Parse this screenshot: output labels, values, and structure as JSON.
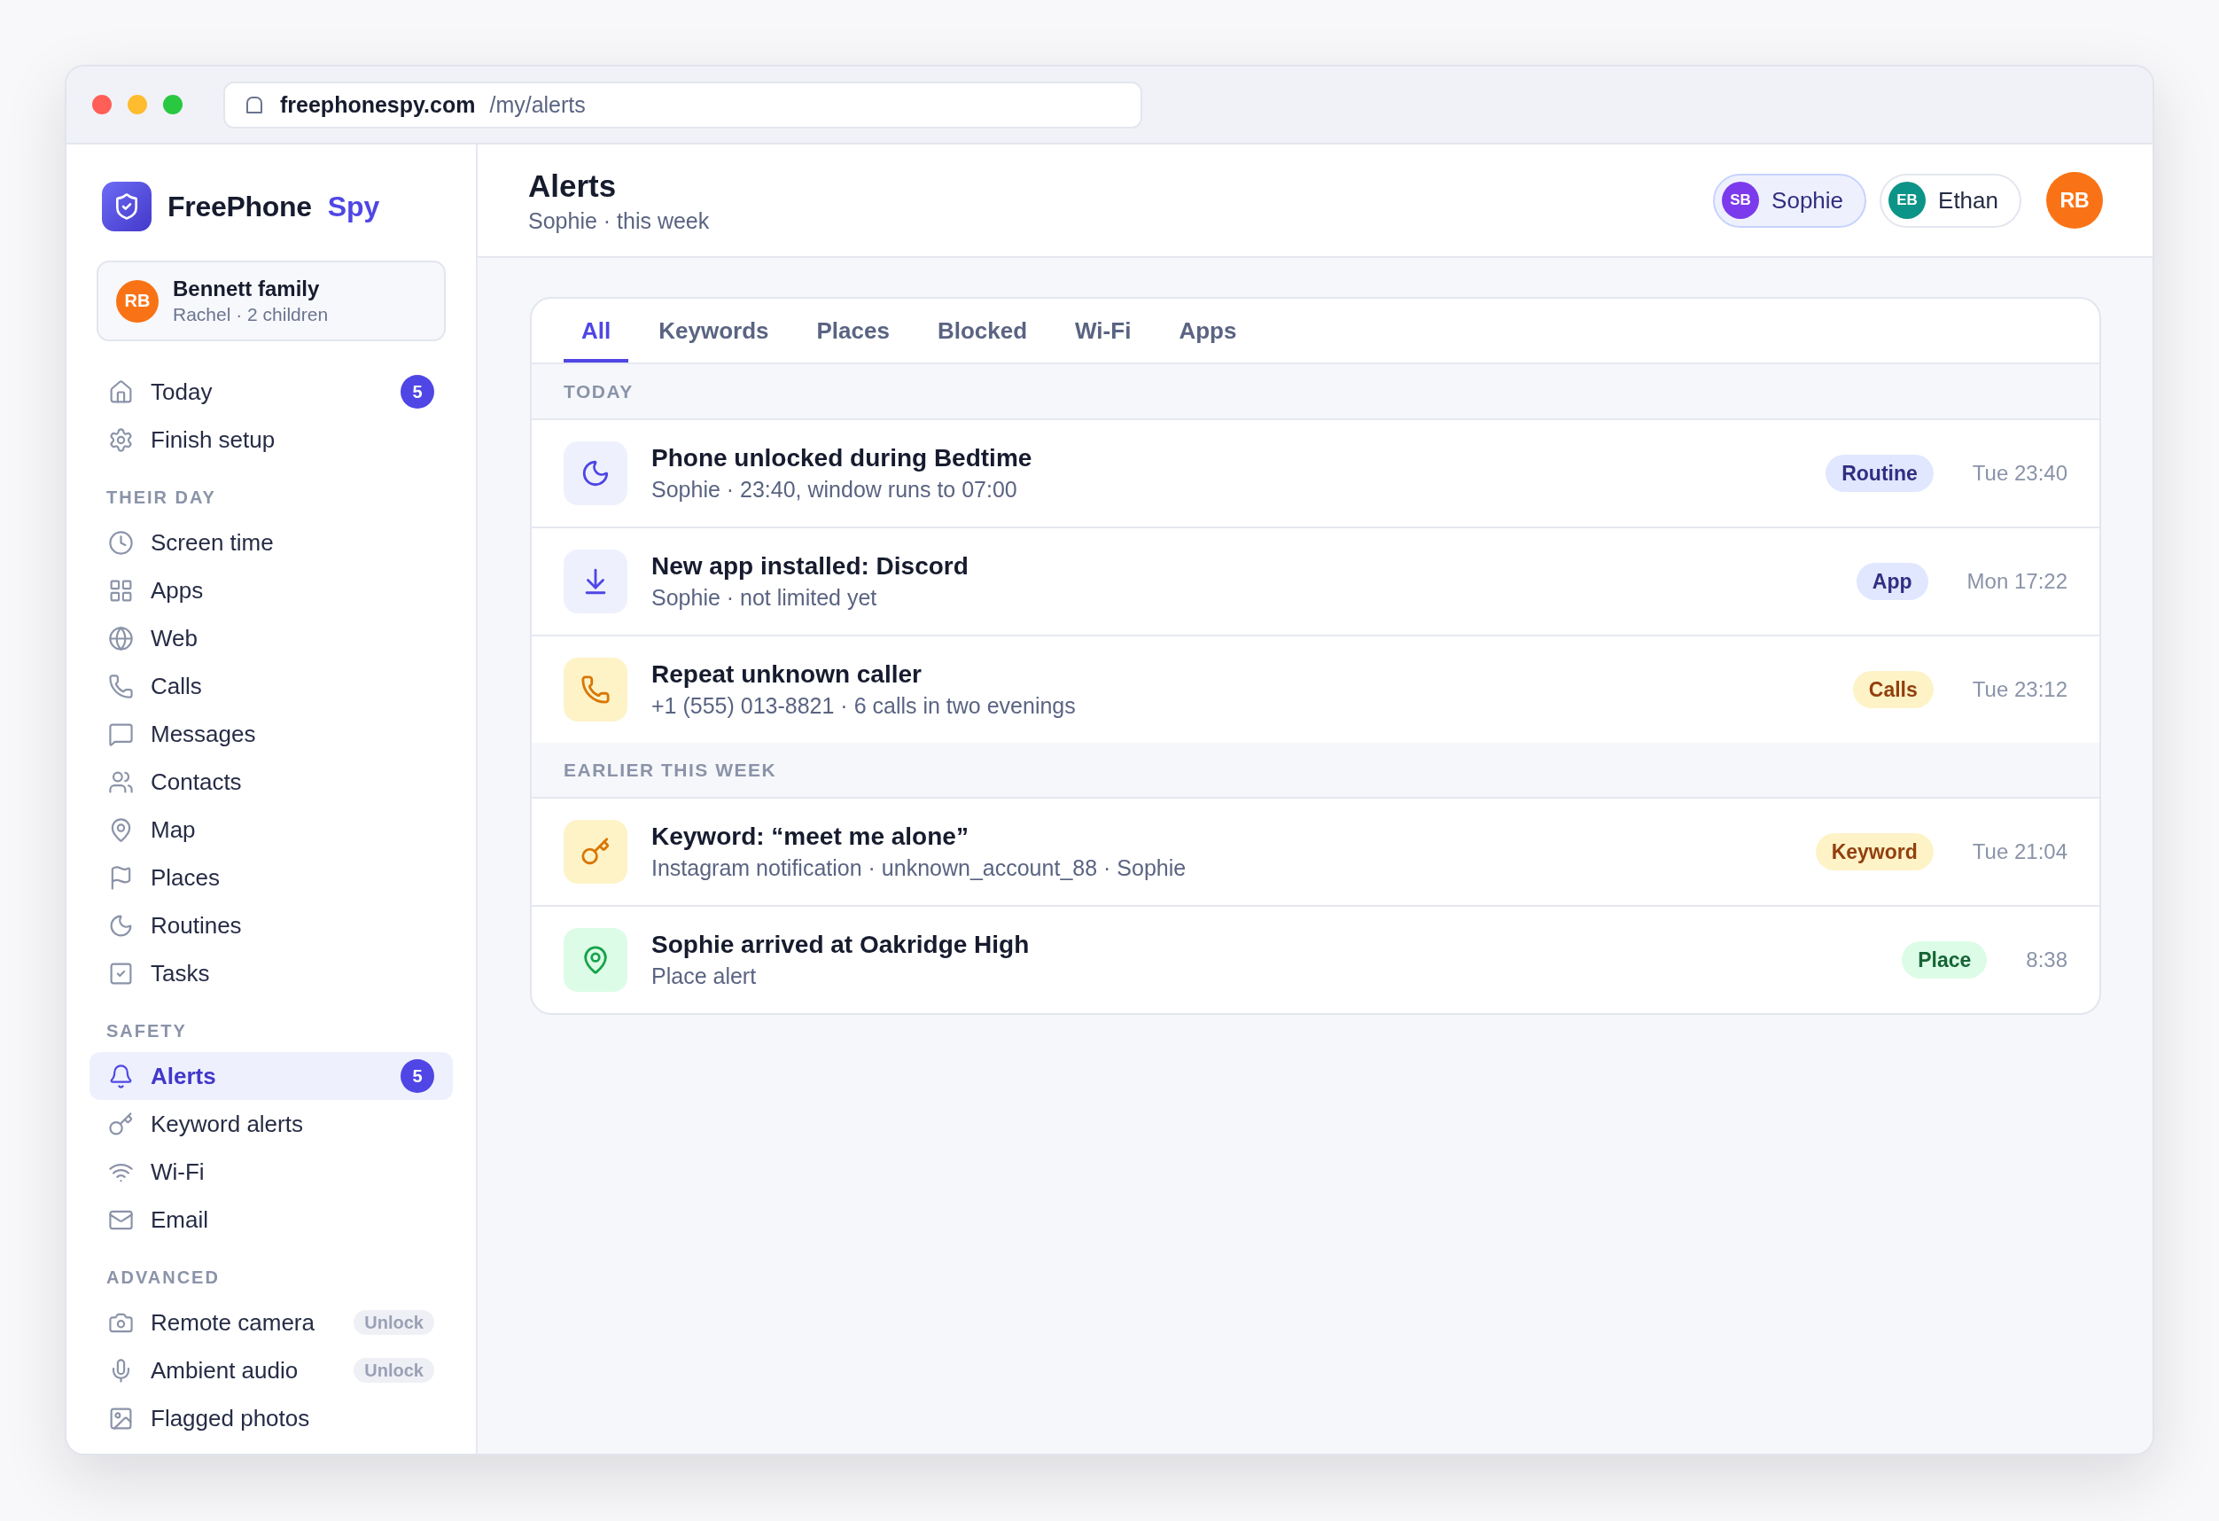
{
  "browser": {
    "domain": "freephonespy.com",
    "path": "/my/alerts"
  },
  "sidebar": {
    "brand": {
      "name": "FreePhone",
      "accent": "Spy"
    },
    "account": {
      "initials": "RB",
      "name": "Bennett family",
      "subtitle": "Rachel · 2 children"
    },
    "sections": [
      {
        "items": [
          {
            "label": "Today",
            "badge": "5",
            "selected": false
          },
          {
            "label": "Finish setup",
            "selected": false
          }
        ]
      },
      {
        "title": "THEIR DAY",
        "items": [
          {
            "label": "Screen time",
            "selected": false
          },
          {
            "label": "Apps",
            "selected": false
          },
          {
            "label": "Web",
            "selected": false
          },
          {
            "label": "Calls",
            "selected": false
          },
          {
            "label": "Messages",
            "selected": false
          },
          {
            "label": "Contacts",
            "selected": false
          },
          {
            "label": "Map",
            "selected": false
          },
          {
            "label": "Places",
            "selected": false
          },
          {
            "label": "Routines",
            "selected": false
          },
          {
            "label": "Tasks",
            "selected": false
          }
        ]
      },
      {
        "title": "SAFETY",
        "items": [
          {
            "label": "Alerts",
            "badge": "5",
            "selected": true
          },
          {
            "label": "Keyword alerts",
            "selected": false
          },
          {
            "label": "Wi-Fi",
            "selected": false
          },
          {
            "label": "Email",
            "selected": false
          }
        ]
      },
      {
        "title": "ADVANCED",
        "items": [
          {
            "label": "Remote camera",
            "tag": "Unlock",
            "selected": false
          },
          {
            "label": "Ambient audio",
            "tag": "Unlock",
            "selected": false
          },
          {
            "label": "Flagged photos",
            "selected": false
          }
        ]
      }
    ]
  },
  "header": {
    "title": "Alerts",
    "subtitle": "Sophie · this week",
    "children": [
      {
        "initials": "SB",
        "name": "Sophie",
        "color": "#7c3aed",
        "selected": true
      },
      {
        "initials": "EB",
        "name": "Ethan",
        "color": "#0d9488",
        "selected": false
      }
    ],
    "user": {
      "initials": "RB"
    }
  },
  "alerts": {
    "tabs": [
      {
        "label": "All",
        "selected": true
      },
      {
        "label": "Keywords",
        "selected": false
      },
      {
        "label": "Places",
        "selected": false
      },
      {
        "label": "Blocked",
        "selected": false
      },
      {
        "label": "Wi-Fi",
        "selected": false
      },
      {
        "label": "Apps",
        "selected": false
      }
    ],
    "groups": [
      {
        "title": "TODAY",
        "items": [
          {
            "kind": "routine",
            "title": "Phone unlocked during Bedtime",
            "detail": "Sophie · 23:40, window runs to 07:00",
            "tag": "Routine",
            "time": "Tue 23:40"
          },
          {
            "kind": "app",
            "title": "New app installed: Discord",
            "detail": "Sophie · not limited yet",
            "tag": "App",
            "time": "Mon 17:22"
          },
          {
            "kind": "calls",
            "title": "Repeat unknown caller",
            "detail": "+1 (555) 013-8821 · 6 calls in two evenings",
            "tag": "Calls",
            "time": "Tue 23:12"
          }
        ]
      },
      {
        "title": "EARLIER THIS WEEK",
        "items": [
          {
            "kind": "keyword",
            "title": "Keyword: “meet me alone”",
            "detail": "Instagram notification · unknown_account_88 · Sophie",
            "tag": "Keyword",
            "time": "Tue 21:04"
          },
          {
            "kind": "place",
            "title": "Sophie arrived at Oakridge High",
            "detail": "Place alert",
            "tag": "Place",
            "time": "8:38"
          }
        ]
      }
    ]
  }
}
